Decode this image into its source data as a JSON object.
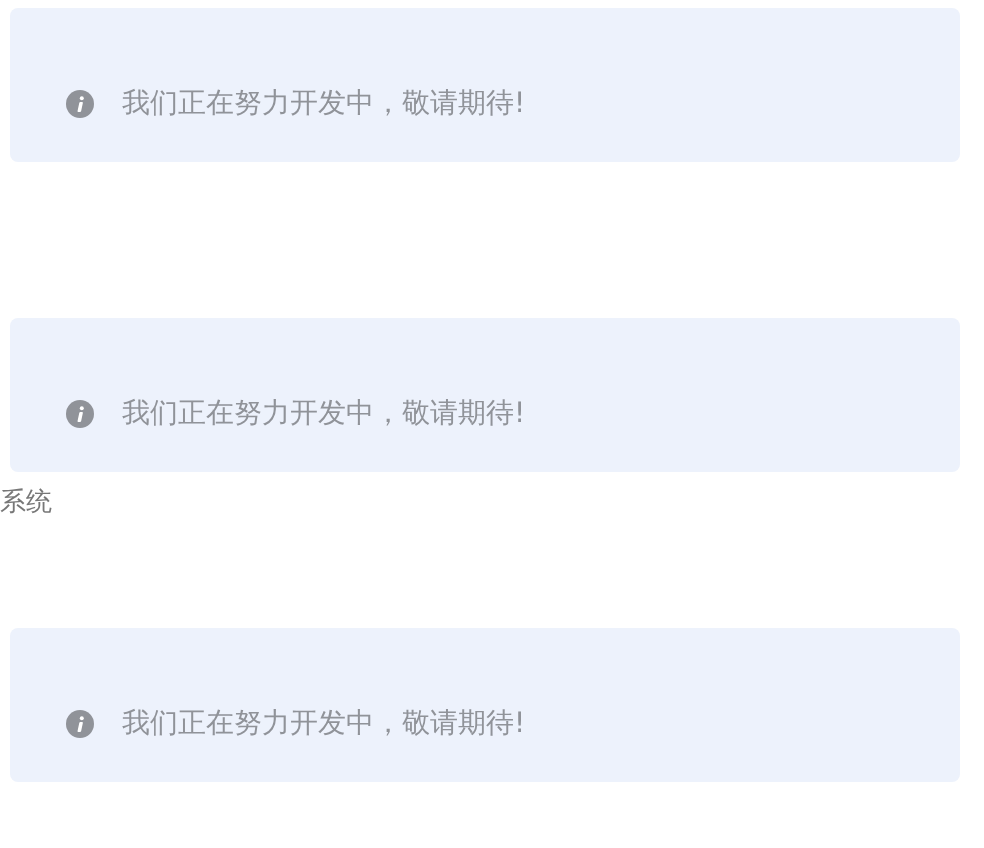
{
  "items": [
    {
      "kind": "alert",
      "message": "我们正在努力开发中，敬请期待!"
    },
    {
      "kind": "alert",
      "message": "我们正在努力开发中，敬请期待!"
    },
    {
      "kind": "label",
      "text": "系统"
    },
    {
      "kind": "alert",
      "message": "我们正在努力开发中，敬请期待!"
    }
  ]
}
